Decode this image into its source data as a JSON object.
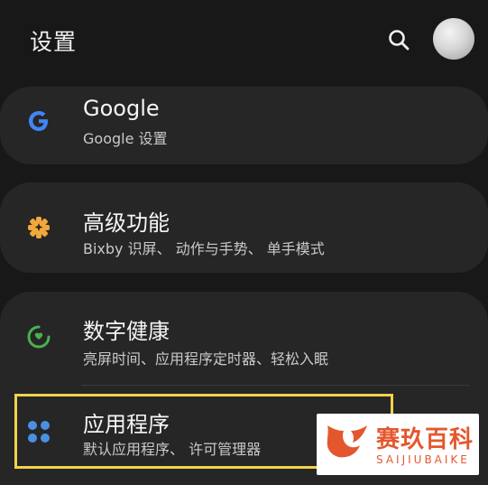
{
  "header": {
    "title": "设置"
  },
  "items": [
    {
      "label": "Google",
      "subtitle": "Google 设置",
      "icon": "google-icon"
    },
    {
      "label": "高级功能",
      "subtitle": "Bixby 识屏、 动作与手势、 单手模式",
      "icon": "advanced-features-icon"
    },
    {
      "label": "数字健康",
      "subtitle": "亮屏时间、应用程序定时器、轻松入眠",
      "icon": "digital-wellbeing-icon"
    },
    {
      "label": "应用程序",
      "subtitle": "默认应用程序、 许可管理器",
      "icon": "apps-icon"
    }
  ],
  "watermark": {
    "title": "赛玖百科",
    "subtitle": "SAIJIUBAIKE"
  },
  "colors": {
    "background": "#181818",
    "card": "#262626",
    "highlight": "#f0d34a",
    "google_blue": "#4285f4",
    "advanced_orange": "#f2a73b",
    "wellbeing_green": "#4caf50",
    "apps_blue": "#4a90e2",
    "watermark_red": "#e4572e"
  }
}
